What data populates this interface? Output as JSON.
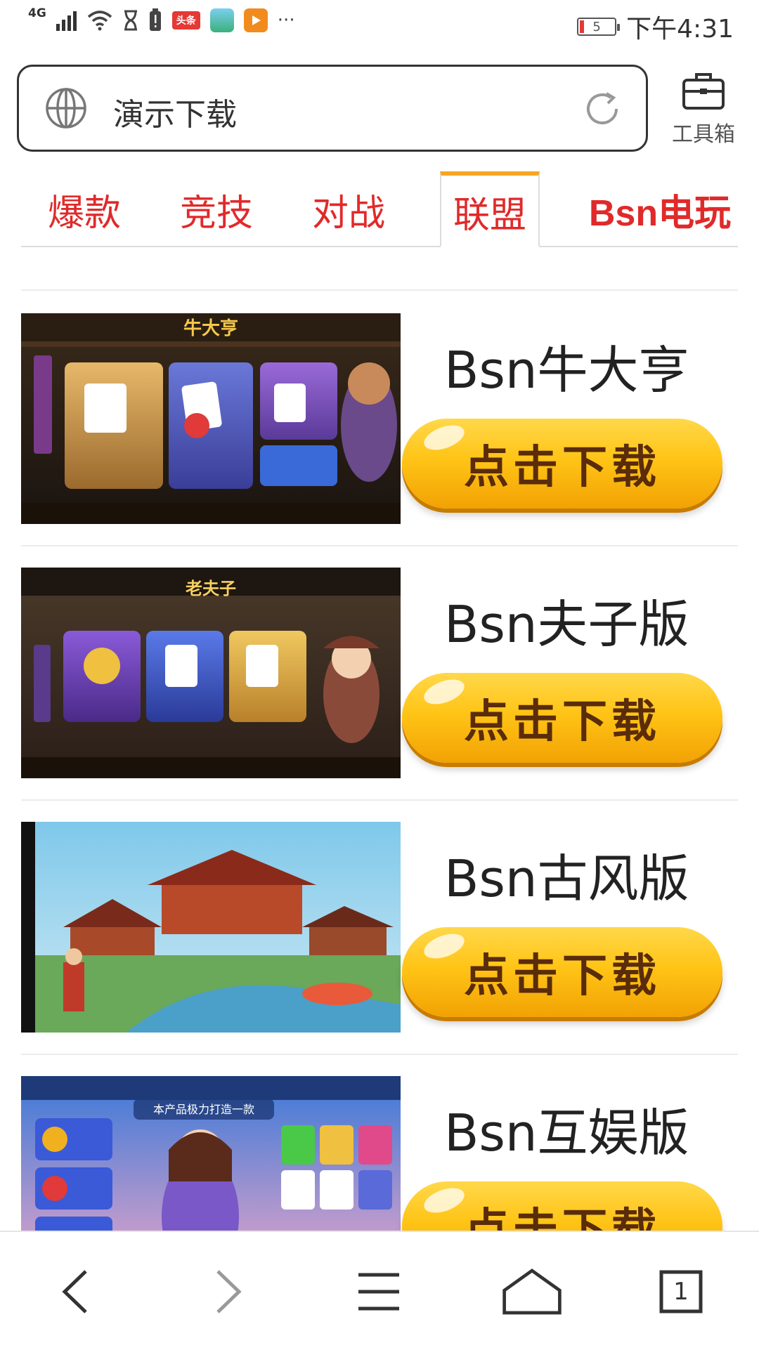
{
  "status_bar": {
    "network": "4G",
    "app_badge_1": "头条",
    "more": "···",
    "battery_level": "5",
    "time": "下午4:31"
  },
  "search": {
    "query": "演示下载",
    "toolbox_label": "工具箱"
  },
  "tabs": [
    {
      "label": "爆款",
      "active": false
    },
    {
      "label": "竞技",
      "active": false
    },
    {
      "label": "对战",
      "active": false
    },
    {
      "label": "联盟",
      "active": true
    },
    {
      "label": "Bsn电玩",
      "active": false
    }
  ],
  "items": [
    {
      "title": "Bsn牛大亨",
      "button": "点击下载"
    },
    {
      "title": "Bsn夫子版",
      "button": "点击下载"
    },
    {
      "title": "Bsn古风版",
      "button": "点击下载"
    },
    {
      "title": "Bsn互娱版",
      "button": "点击下载"
    }
  ],
  "bottom_nav": {
    "tab_count": "1"
  },
  "colors": {
    "tab_text": "#e02a2a",
    "tab_active_border": "#f5a623",
    "button_gradient_top": "#ffd84a",
    "button_gradient_bottom": "#f2a204",
    "button_text": "#5a2c0a"
  },
  "icons": [
    "globe-icon",
    "reload-icon",
    "toolbox-icon",
    "back-icon",
    "forward-icon",
    "menu-icon",
    "home-icon",
    "tabs-icon"
  ]
}
